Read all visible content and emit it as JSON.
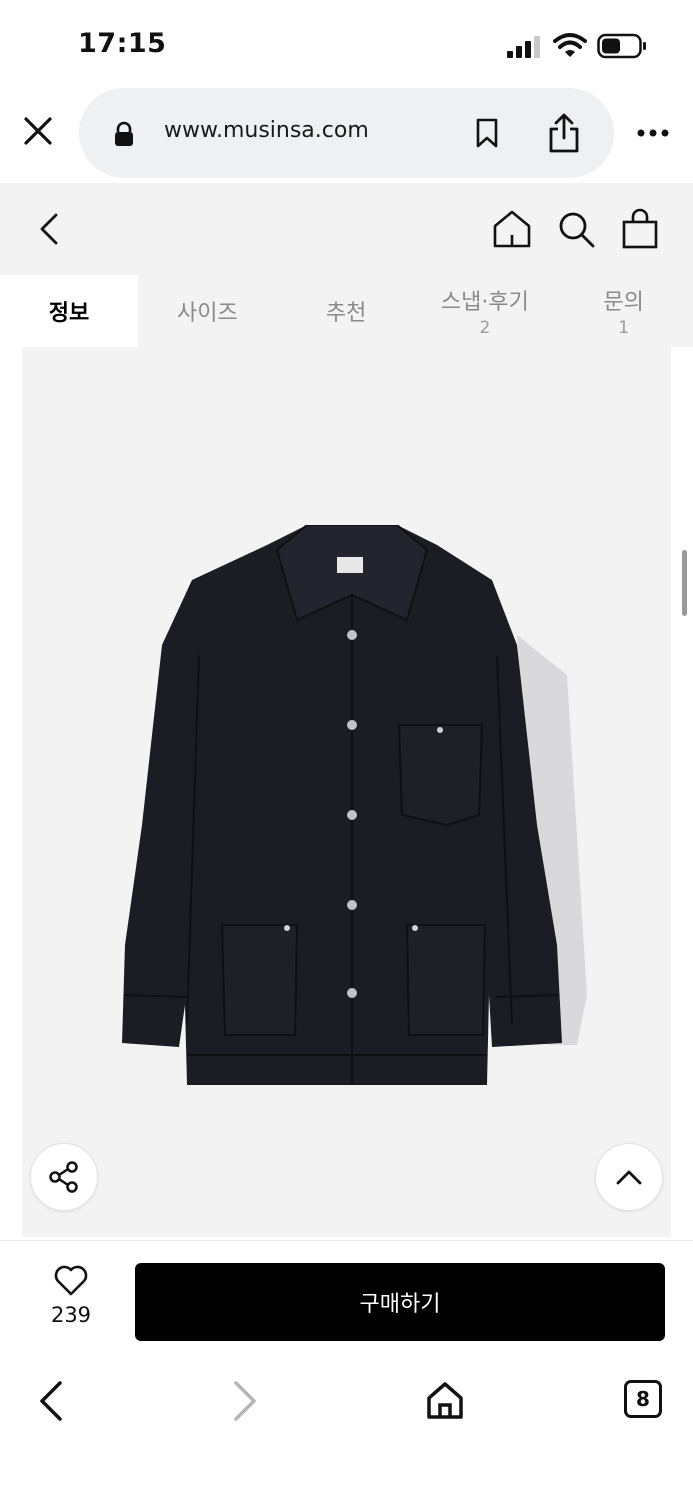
{
  "status": {
    "time": "17:15"
  },
  "browser": {
    "url": "www.musinsa.com"
  },
  "tabs": [
    {
      "label": "정보",
      "count": ""
    },
    {
      "label": "사이즈",
      "count": ""
    },
    {
      "label": "추천",
      "count": ""
    },
    {
      "label": "스냅·후기",
      "count": "2"
    },
    {
      "label": "문의",
      "count": "1"
    }
  ],
  "purchase": {
    "likes": "239",
    "buy_label": "구매하기"
  },
  "toolbar": {
    "tab_count": "8"
  },
  "colors": {
    "buy_button": "#000000",
    "header_bg": "#f3f3f4",
    "image_bg": "#f3f3f4"
  }
}
